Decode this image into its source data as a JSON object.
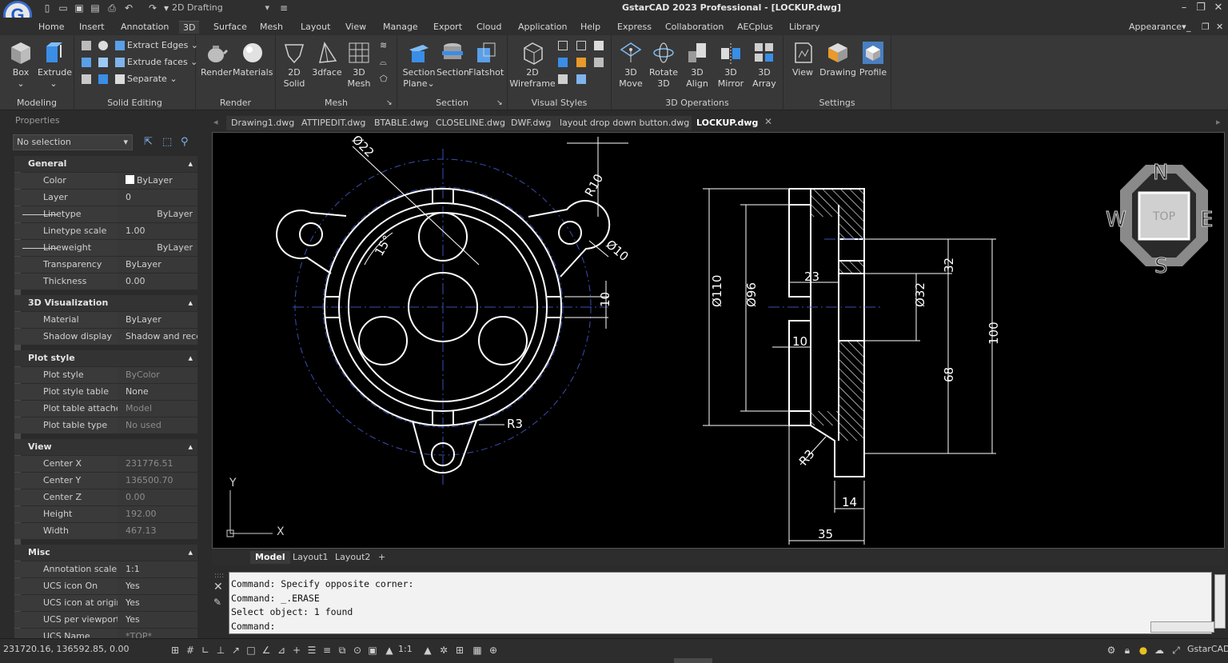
{
  "app": {
    "title": "GstarCAD 2023 Professional - [LOCKUP.dwg]",
    "workspace": "2D Drafting",
    "logo_letter": "G"
  },
  "menu": [
    "Home",
    "Insert",
    "Annotation",
    "3D",
    "Surface",
    "Mesh",
    "Layout",
    "View",
    "Manage",
    "Export",
    "Cloud",
    "Application",
    "Help",
    "Express",
    "Collaboration",
    "AECplus",
    "Library"
  ],
  "menu_active": "3D",
  "appearance": "Appearance",
  "ribbon": {
    "modeling": {
      "label": "Modeling",
      "box": "Box",
      "extrude": "Extrude"
    },
    "solid_editing": {
      "label": "Solid Editing",
      "extract_edges": "Extract Edges",
      "extrude_faces": "Extrude faces",
      "separate": "Separate"
    },
    "render": {
      "label": "Render",
      "render": "Render",
      "materials": "Materials"
    },
    "mesh": {
      "label": "Mesh",
      "solid": "2D\nSolid",
      "solid1": "2D",
      "solid2": "Solid",
      "threedface": "3dface",
      "mesh1": "3D",
      "mesh2": "Mesh"
    },
    "section": {
      "label": "Section",
      "plane1": "Section",
      "plane2": "Plane",
      "section": "Section",
      "flatshot": "Flatshot"
    },
    "visual": {
      "label": "Visual Styles",
      "wire1": "2D",
      "wire2": "Wireframe"
    },
    "ops": {
      "label": "3D Operations",
      "move1": "3D",
      "move2": "Move",
      "rot1": "Rotate",
      "rot2": "3D",
      "align1": "3D",
      "align2": "Align",
      "mirror1": "3D",
      "mirror2": "Mirror",
      "array1": "3D",
      "array2": "Array"
    },
    "settings": {
      "label": "Settings",
      "view": "View",
      "drawing": "Drawing",
      "profile": "Profile"
    }
  },
  "properties": {
    "title": "Properties",
    "selection": "No selection",
    "sections": [
      {
        "name": "General",
        "rows": [
          [
            "Color",
            "ByLayer"
          ],
          [
            "Layer",
            "0"
          ],
          [
            "Linetype",
            "ByLayer"
          ],
          [
            "Linetype scale",
            "1.00"
          ],
          [
            "Lineweight",
            "ByLayer"
          ],
          [
            "Transparency",
            "ByLayer"
          ],
          [
            "Thickness",
            "0.00"
          ]
        ]
      },
      {
        "name": "3D Visualization",
        "rows": [
          [
            "Material",
            "ByLayer"
          ],
          [
            "Shadow display",
            "Shadow and recei..."
          ]
        ]
      },
      {
        "name": "Plot style",
        "rows": [
          [
            "Plot style",
            "ByColor"
          ],
          [
            "Plot style table",
            "None"
          ],
          [
            "Plot table attache...",
            "Model"
          ],
          [
            "Plot table type",
            "No used"
          ]
        ]
      },
      {
        "name": "View",
        "rows": [
          [
            "Center X",
            "231776.51"
          ],
          [
            "Center Y",
            "136500.70"
          ],
          [
            "Center Z",
            "0.00"
          ],
          [
            "Height",
            "192.00"
          ],
          [
            "Width",
            "467.13"
          ]
        ]
      },
      {
        "name": "Misc",
        "rows": [
          [
            "Annotation scale",
            "1:1"
          ],
          [
            "UCS icon On",
            "Yes"
          ],
          [
            "UCS icon at origin",
            "Yes"
          ],
          [
            "UCS per viewport",
            "Yes"
          ],
          [
            "UCS Name",
            "*TOP*"
          ]
        ]
      }
    ]
  },
  "doc_tabs": [
    "Drawing1.dwg",
    "ATTIPEDIT.dwg",
    "BTABLE.dwg",
    "CLOSELINE.dwg",
    "DWF.dwg",
    "layout drop down button.dwg",
    "LOCKUP.dwg"
  ],
  "layout_tabs": [
    "Model",
    "Layout1",
    "Layout2",
    "+"
  ],
  "drawing": {
    "dims_left": [
      "Ø22",
      "R10",
      "Ø10",
      "15°",
      "10",
      "R3"
    ],
    "dims_right": [
      "Ø110",
      "Ø96",
      "23",
      "10",
      "Ø32",
      "32",
      "68",
      "100",
      "R3",
      "14",
      "35"
    ],
    "viewcube": {
      "top": "TOP",
      "n": "N",
      "s": "S",
      "e": "E",
      "w": "W"
    },
    "ucs": {
      "x": "X",
      "y": "Y"
    }
  },
  "command": {
    "lines": [
      "Command: Specify opposite corner:",
      "Command: _.ERASE",
      "Select object:  1 found"
    ],
    "prompt": "Command:"
  },
  "status": {
    "coords": "231720.16, 136592.85, 0.00",
    "brand": "GstarCAD",
    "scale": "1:1"
  }
}
